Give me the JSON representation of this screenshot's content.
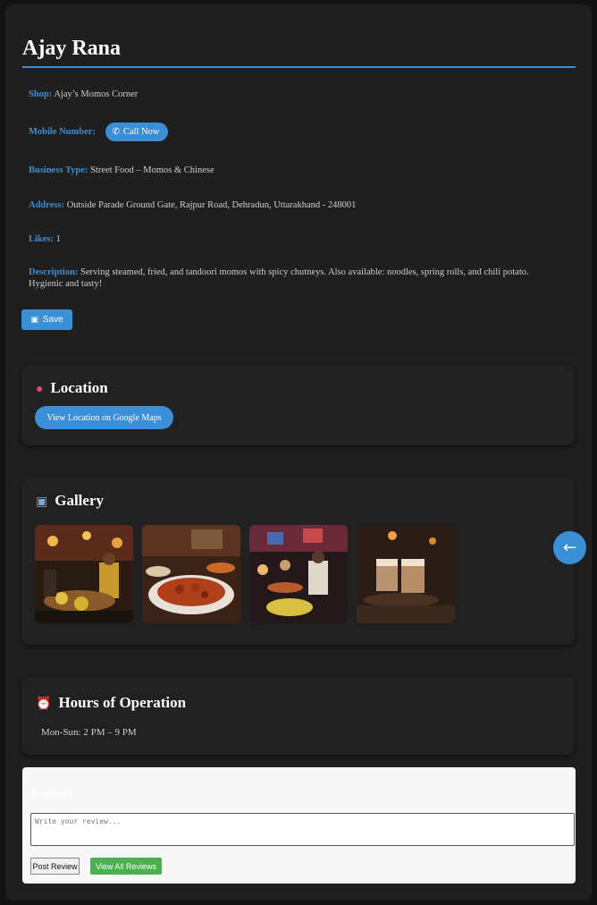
{
  "profile": {
    "name": "Ajay Rana",
    "shop_label": "Shop:",
    "shop": "Ajay’s Momos Corner",
    "mobile_label": "Mobile Number:",
    "call_label": "Call Now",
    "business_label": "Business Type:",
    "business": "Street Food – Momos & Chinese",
    "address_label": "Address:",
    "address": "Outside Parade Ground Gate, Rajpur Road, Dehradun, Uttarakhand - 248001",
    "likes_label": "Likes:",
    "likes": "1",
    "description_label": "Description:",
    "description": "Serving steamed, fried, and tandoori momos with spicy chutneys. Also available: noodles, spring rolls, and chili potato. Hygienic and tasty!",
    "save_label": "Save"
  },
  "location": {
    "title": "Location",
    "icon": "pin-icon",
    "button_label": "View Location on Google Maps"
  },
  "gallery": {
    "title": "Gallery",
    "icon": "camera-icon",
    "images": [
      {
        "name": "street-food-stall-photo"
      },
      {
        "name": "curry-plate-photo"
      },
      {
        "name": "night-market-cooking-photo"
      },
      {
        "name": "chai-glasses-photo"
      }
    ],
    "nav_icon": "arrow-left-icon"
  },
  "hours": {
    "title": "Hours of Operation",
    "icon": "alarm-clock-icon",
    "text": "Mon-Sun: 2 PM – 9 PM"
  },
  "reviews": {
    "title": "Reviews",
    "placeholder": "Write your review...",
    "post_label": "Post Review",
    "view_all_label": "View All Reviews"
  },
  "colors": {
    "accent": "#3b8fd6",
    "green": "#4caf50",
    "background": "#1f1f1f"
  }
}
